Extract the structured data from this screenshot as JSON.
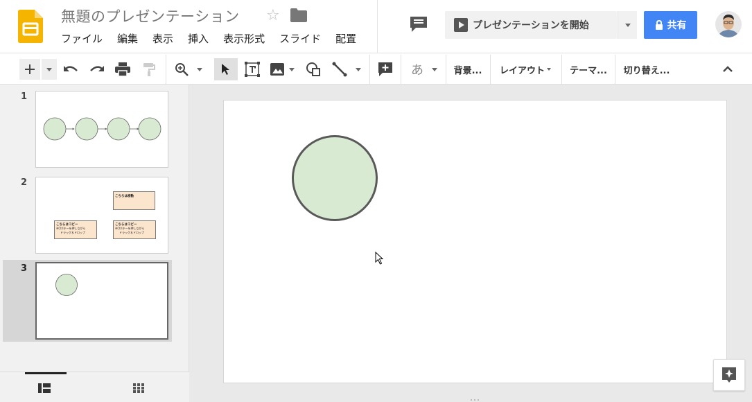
{
  "header": {
    "doc_title": "無題のプレゼンテーション",
    "menu": [
      "ファイル",
      "編集",
      "表示",
      "挿入",
      "表示形式",
      "スライド",
      "配置"
    ],
    "present_label": "プレゼンテーションを開始",
    "share_label": "共有"
  },
  "toolbar": {
    "ime_label": "あ",
    "background_label": "背景...",
    "layout_label": "レイアウト",
    "theme_label": "テーマ...",
    "transition_label": "切り替え..."
  },
  "filmstrip": {
    "slides": [
      {
        "number": "1"
      },
      {
        "number": "2",
        "boxes": [
          {
            "title": "こちらは移動"
          },
          {
            "title": "こちらはコピー",
            "line1": "※Ctrlキーを押しながら",
            "line2": "ドラッグ＆ドロップ"
          },
          {
            "title": "こちらはコピー",
            "line1": "※Ctrlキーを押しながら",
            "line2": "ドラッグ＆ドロップ"
          }
        ]
      },
      {
        "number": "3",
        "selected": true
      }
    ]
  },
  "colors": {
    "circle_fill": "#d9ead3",
    "circle_stroke": "#595959",
    "box_fill": "#fce5cd",
    "share_blue": "#4285f4",
    "logo_yellow": "#f4b400"
  }
}
